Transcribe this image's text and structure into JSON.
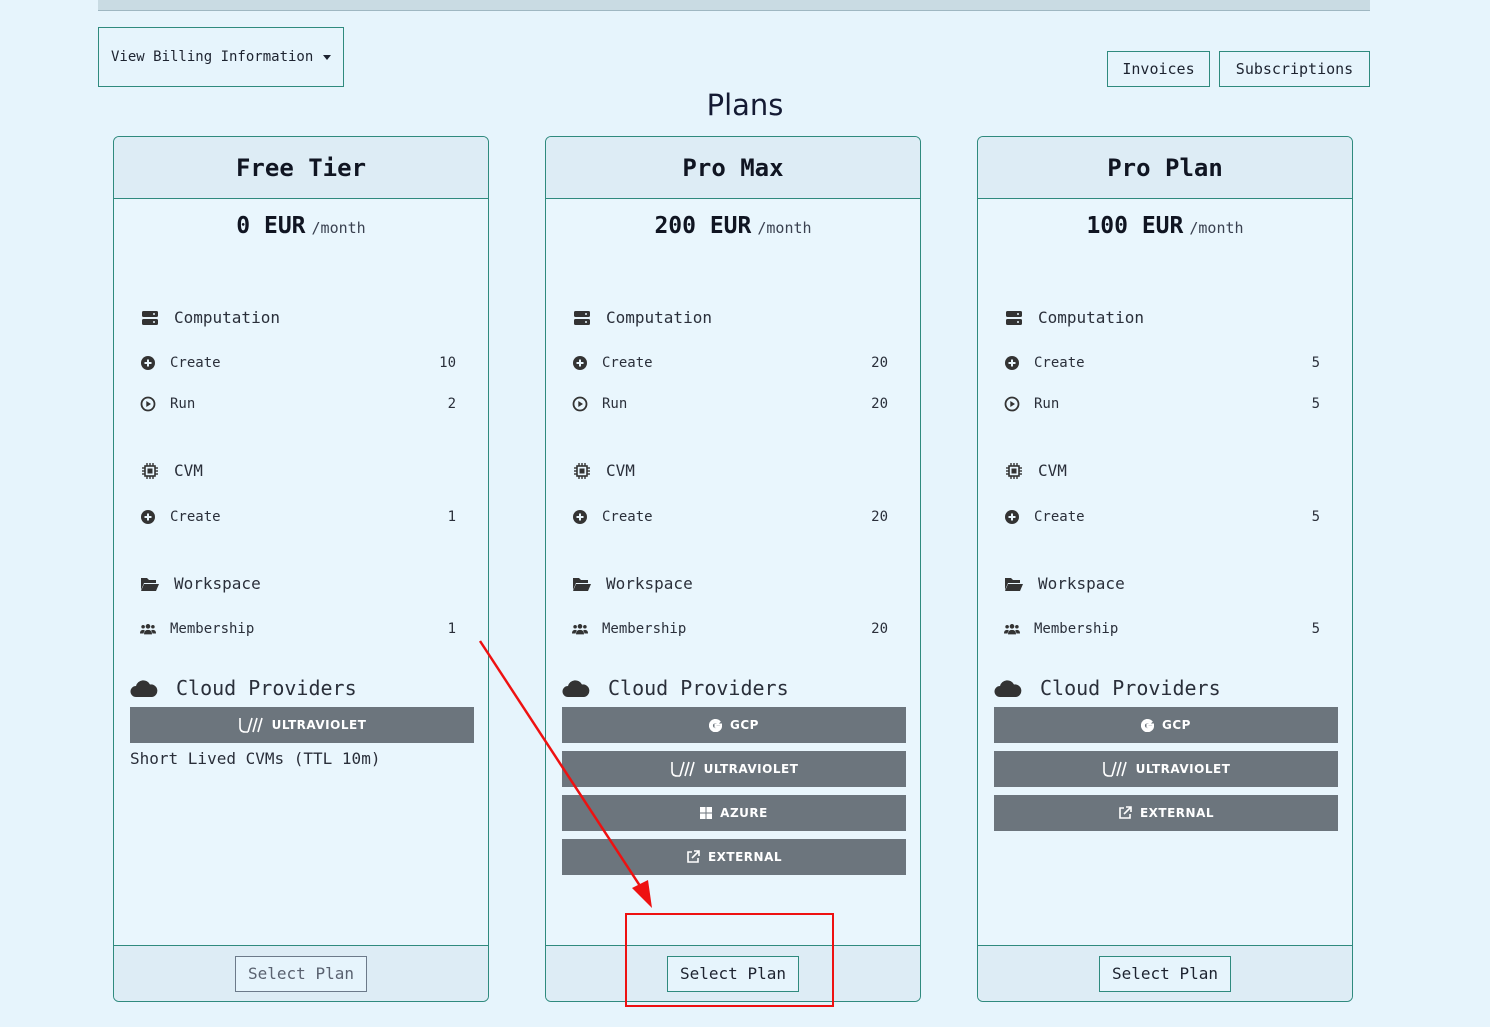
{
  "billing_dropdown": {
    "label": "View Billing Information"
  },
  "top_buttons": {
    "invoices": "Invoices",
    "subscriptions": "Subscriptions"
  },
  "page_title": "Plans",
  "plans": [
    {
      "name": "Free Tier",
      "price": "0 EUR",
      "period": "/month",
      "computation": {
        "title": "Computation",
        "create_label": "Create",
        "create": "10",
        "run_label": "Run",
        "run": "2"
      },
      "cvm": {
        "title": "CVM",
        "create_label": "Create",
        "create": "1"
      },
      "workspace": {
        "title": "Workspace",
        "membership_label": "Membership",
        "membership": "1"
      },
      "cloud_title": "Cloud Providers",
      "providers": [
        "ULTRAVIOLET"
      ],
      "note": "Short Lived CVMs (TTL 10m)",
      "select_label": "Select Plan"
    },
    {
      "name": "Pro Max",
      "price": "200 EUR",
      "period": "/month",
      "computation": {
        "title": "Computation",
        "create_label": "Create",
        "create": "20",
        "run_label": "Run",
        "run": "20"
      },
      "cvm": {
        "title": "CVM",
        "create_label": "Create",
        "create": "20"
      },
      "workspace": {
        "title": "Workspace",
        "membership_label": "Membership",
        "membership": "20"
      },
      "cloud_title": "Cloud Providers",
      "providers": [
        "GCP",
        "ULTRAVIOLET",
        "AZURE",
        "EXTERNAL"
      ],
      "select_label": "Select Plan"
    },
    {
      "name": "Pro Plan",
      "price": "100 EUR",
      "period": "/month",
      "computation": {
        "title": "Computation",
        "create_label": "Create",
        "create": "5",
        "run_label": "Run",
        "run": "5"
      },
      "cvm": {
        "title": "CVM",
        "create_label": "Create",
        "create": "5"
      },
      "workspace": {
        "title": "Workspace",
        "membership_label": "Membership",
        "membership": "5"
      },
      "cloud_title": "Cloud Providers",
      "providers": [
        "GCP",
        "ULTRAVIOLET",
        "EXTERNAL"
      ],
      "select_label": "Select Plan"
    }
  ],
  "icons": {
    "computation": "server-icon",
    "create": "plus-circle-icon",
    "run": "play-circle-icon",
    "cvm": "chip-icon",
    "workspace": "folder-open-icon",
    "membership": "users-icon",
    "cloud": "cloud-icon",
    "GCP": "google-icon",
    "ULTRAVIOLET": "ultraviolet-icon",
    "AZURE": "windows-icon",
    "EXTERNAL": "external-link-icon"
  },
  "colors": {
    "accent": "#2f8a7e",
    "provider_bg": "#6c757d",
    "annotation": "#ee1111"
  }
}
